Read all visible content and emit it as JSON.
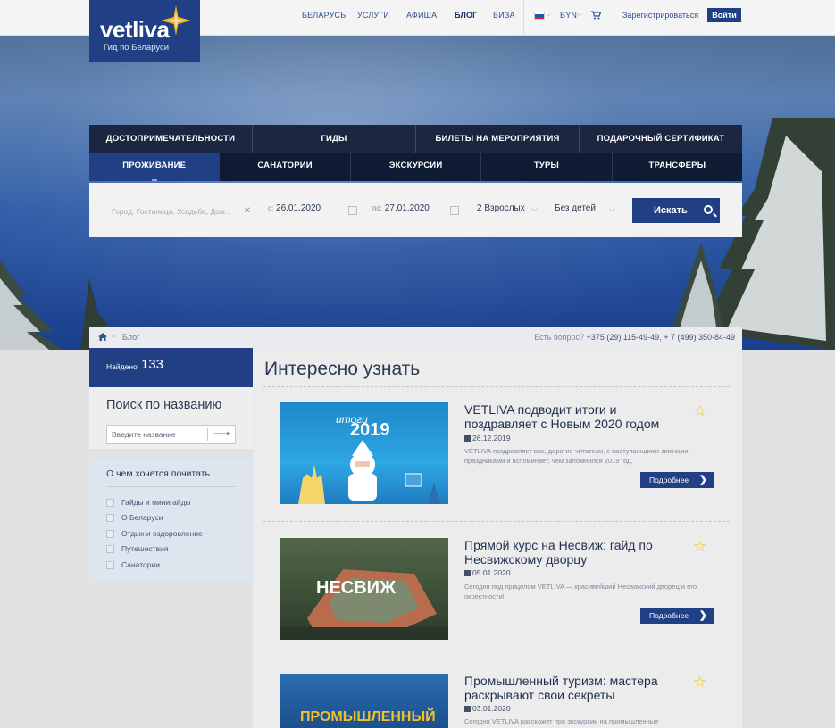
{
  "header": {
    "brand": "vetliva",
    "tagline": "Гид по Беларуси",
    "nav": [
      "БЕЛАРУСЬ",
      "УСЛУГИ",
      "АФИША",
      "БЛОГ",
      "ВИЗА"
    ],
    "active_nav": "БЛОГ",
    "currency": "BYN",
    "register": "Зарегистрироваться",
    "login": "Войти"
  },
  "menu": {
    "row1": [
      "Достопримечательности",
      "Гиды",
      "Билеты на мероприятия",
      "Подарочный сертификат"
    ],
    "row2": [
      "Проживание",
      "Санатории",
      "Экскурсии",
      "Туры",
      "Трансферы"
    ],
    "active": "Проживание"
  },
  "search_panel": {
    "place_placeholder": "Город, Гостиница, Усадьба, Дом...",
    "from_label": "с:",
    "from_date": "26.01.2020",
    "to_label": "по:",
    "to_date": "27.01.2020",
    "adults": "2 Взрослых",
    "children": "Без детей",
    "search_button": "Искать"
  },
  "breadcrumb": {
    "current": "Блог",
    "phone_label": "Есть вопрос?",
    "phones": "+375 (29) 115-49-49, + 7 (499) 350-84-49"
  },
  "sidebar": {
    "found_label": "Найдено",
    "found_count": "133",
    "search_title": "Поиск по названию",
    "search_placeholder": "Введите название",
    "topics_title": "О чем хочется почитать",
    "topics": [
      "Гайды и минигайды",
      "О Беларуси",
      "Отдых и оздоровление",
      "Путешествия",
      "Санатории"
    ]
  },
  "main": {
    "page_title": "Интересно узнать",
    "more_label": "Подробнее",
    "articles": [
      {
        "title": "VETLIVA подводит итоги и поздравляет с Новым 2020 годом",
        "date": "26.12.2019",
        "desc": "VETLIVA поздравляет вас, дорогие читатели, с наступающими зимними праздниками и вспоминает, чем запомнился 2019 год.",
        "img_text_top": "итоги",
        "img_text_big": "2019"
      },
      {
        "title": "Прямой курс на Несвиж: гайд по Несвижскому дворцу",
        "date": "05.01.2020",
        "desc": "Сегодня под прицелом VETLIVA — красивейший Несвижский дворец и его окрестности!",
        "img_text_big": "НЕСВИЖ"
      },
      {
        "title": "Промышленный туризм: мастера раскрывают свои секреты",
        "date": "03.01.2020",
        "desc": "Сегодня VETLIVA расскажет про экскурсии на промышленные",
        "img_text_big": "ПРОМЫШЛЕННЫЙ"
      }
    ]
  },
  "colors": {
    "brand_blue": "#213f84",
    "dark_menu": "#1b2640",
    "star": "#e7c300"
  }
}
